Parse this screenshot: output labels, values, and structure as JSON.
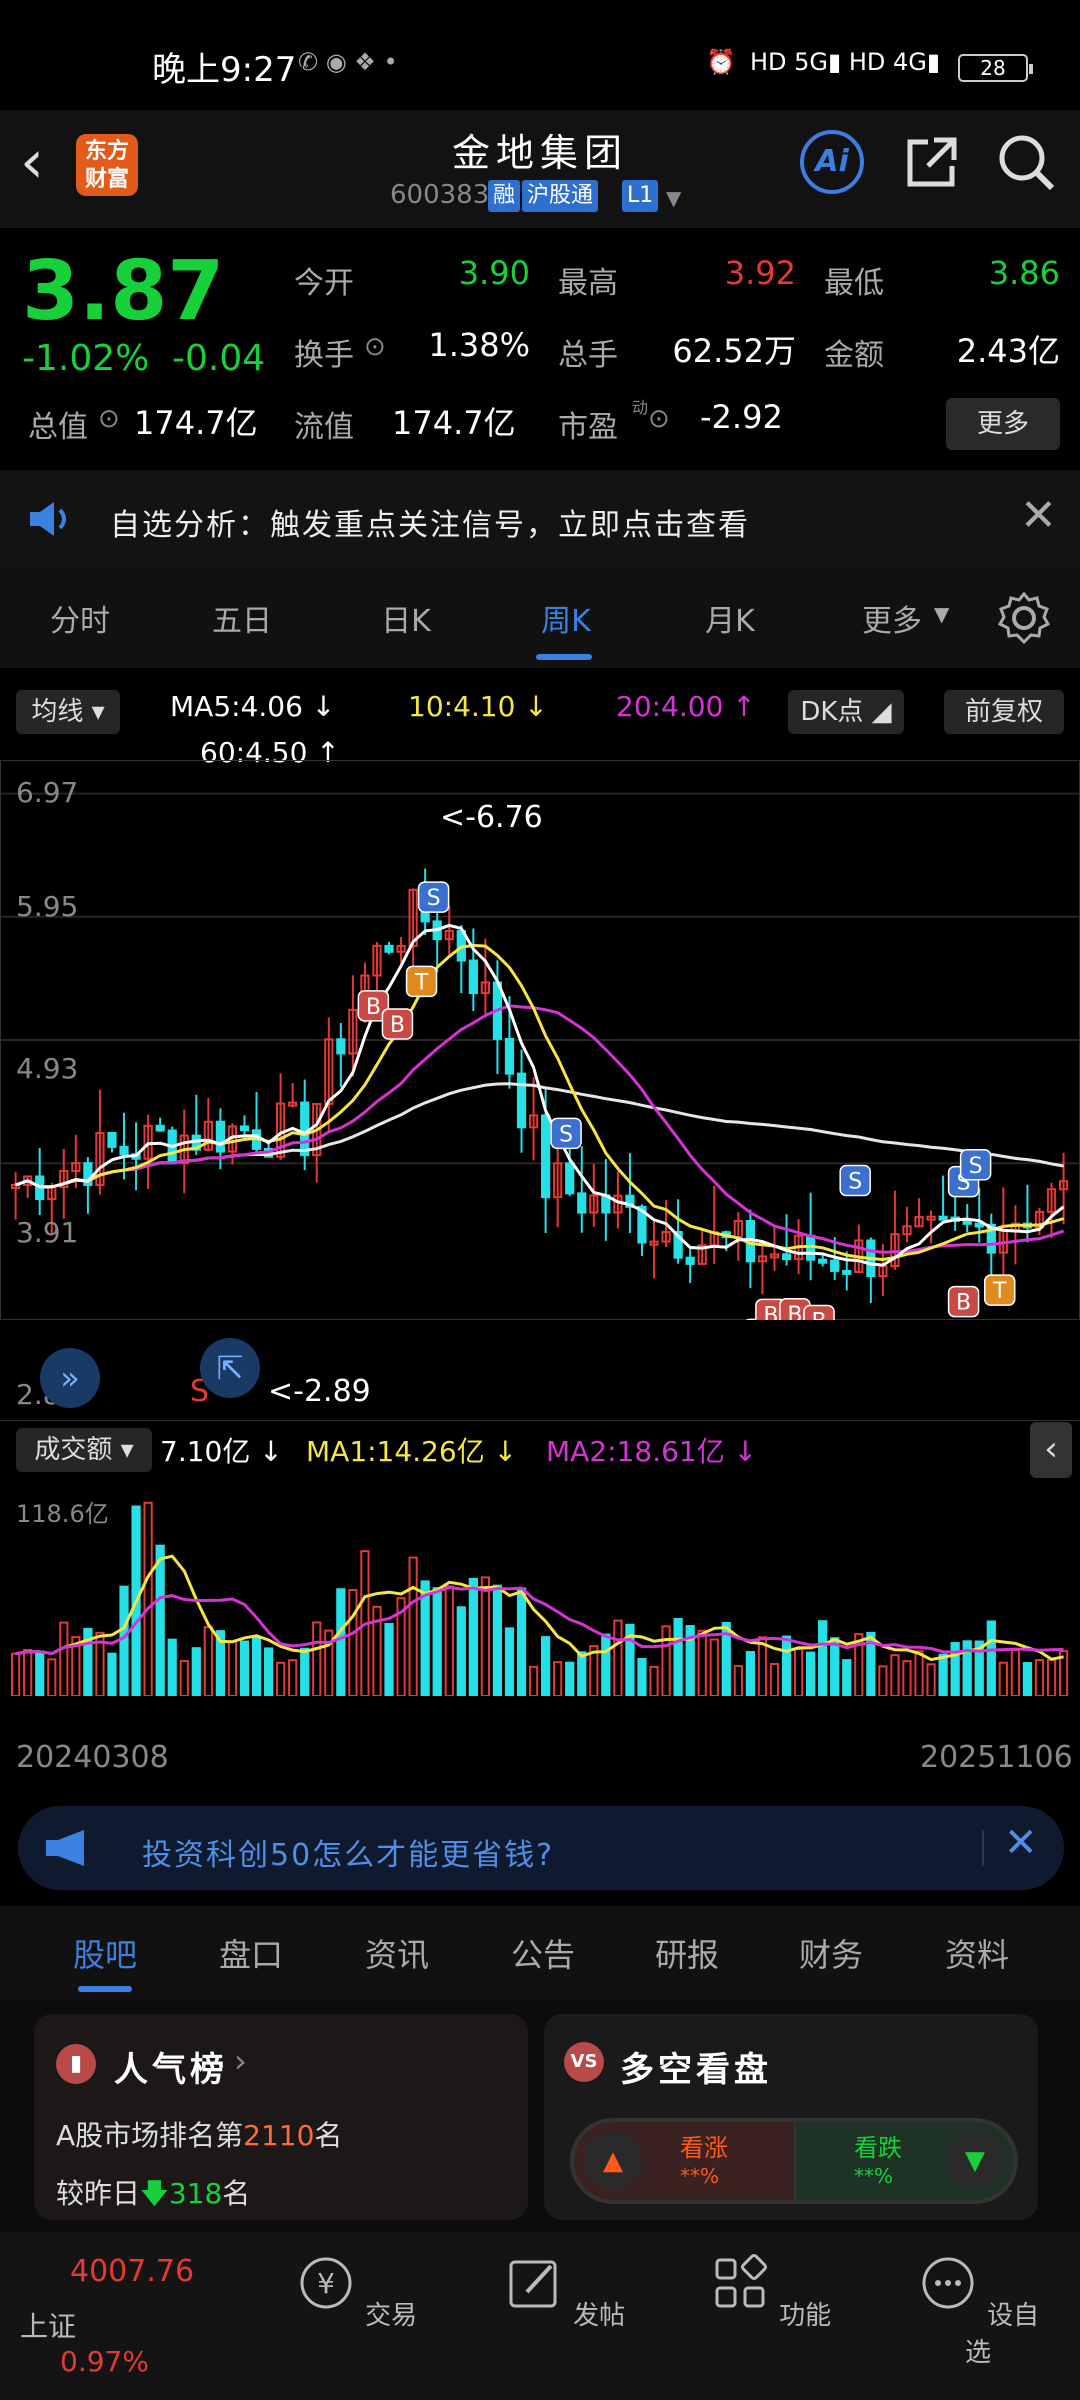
{
  "status_bar": {
    "time": "晚上9:27",
    "battery": "28"
  },
  "header": {
    "logo_text": "东方财富",
    "stock_name": "金地集团",
    "stock_code": "600383",
    "tags": [
      "融",
      "沪股通",
      "L1"
    ],
    "ai_label": "Ai"
  },
  "quote": {
    "price": "3.87",
    "change_pct": "-1.02%",
    "change": "-0.04",
    "open_label": "今开",
    "open": "3.90",
    "high_label": "最高",
    "high": "3.92",
    "low_label": "最低",
    "low": "3.86",
    "turnover_label": "换手",
    "turnover": "1.38%",
    "volume_label": "总手",
    "volume": "62.52万",
    "amount_label": "金额",
    "amount": "2.43亿",
    "mktcap_label": "总值",
    "mktcap": "174.7亿",
    "float_label": "流值",
    "float_cap": "174.7亿",
    "pe_label": "市盈",
    "pe_sup": "动",
    "pe": "-2.92",
    "more_button": "更多"
  },
  "alert": {
    "text": "自选分析：触发重点关注信号，立即点击查看"
  },
  "chart_tabs": {
    "items": [
      "分时",
      "五日",
      "日K",
      "周K",
      "月K",
      "更多"
    ],
    "active": 3
  },
  "chart": {
    "ma_button": "均线",
    "ma5": "MA5:4.06",
    "ma10": "10:4.10",
    "ma20": "20:4.00",
    "ma60": "60:4.50",
    "dk_button": "DK点",
    "fq_button": "前复权",
    "y_labels": [
      "6.97",
      "5.95",
      "4.93",
      "3.91",
      "2.89"
    ],
    "high_mark": "6.76",
    "low_mark": "2.89",
    "s_marker": "S",
    "vol_button": "成交额",
    "vol_value": "7.10亿",
    "vol_ma1": "MA1:14.26亿",
    "vol_ma2": "MA2:18.61亿",
    "vol_axis_max": "118.6亿",
    "date_start": "20240308",
    "date_end": "20251106",
    "colors": {
      "up": "#e53935",
      "down": "#26e0e8",
      "ma5": "#ffffff",
      "ma10": "#f5e642",
      "ma20": "#d633d6",
      "ma60": "#e6e6e6"
    }
  },
  "ad": {
    "text": "投资科创50怎么才能更省钱?"
  },
  "sub_tabs": {
    "items": [
      "股吧",
      "盘口",
      "资讯",
      "公告",
      "研报",
      "财务",
      "资料"
    ],
    "active": 0
  },
  "popularity": {
    "title": "人气榜",
    "line1_pre": "A股市场排名第",
    "line1_num": "2110",
    "line1_post": "名",
    "line2_pre": "较昨日",
    "line2_num": "318",
    "line2_post": "名"
  },
  "bull_bear": {
    "title": "多空看盘",
    "up_label": "看涨",
    "down_label": "看跌",
    "up_value": "**%",
    "down_value": "**%"
  },
  "bottom_nav": {
    "index_value": "4007.76",
    "index_name": "上证",
    "index_change": "0.97%",
    "trade": "交易",
    "post": "发帖",
    "functions": "功能",
    "watchlist": "设自选"
  }
}
